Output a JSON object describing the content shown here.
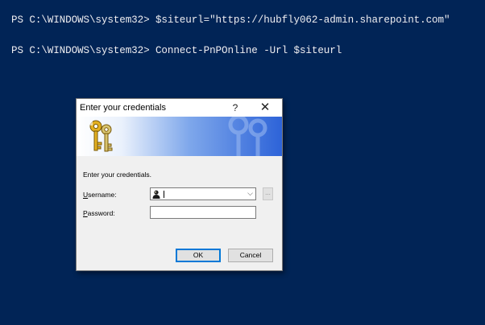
{
  "console": {
    "lines": [
      "PS C:\\WINDOWS\\system32> $siteurl=\"https://hubfly062-admin.sharepoint.com\"",
      "PS C:\\WINDOWS\\system32> Connect-PnPOnline -Url $siteurl"
    ]
  },
  "dialog": {
    "title": "Enter your credentials",
    "help_glyph": "?",
    "close_glyph": "✕",
    "prompt": "Enter your credentials.",
    "username_label_key": "U",
    "username_label_rest": "sername:",
    "username_value": "",
    "password_label_key": "P",
    "password_label_rest": "assword:",
    "browse_label": "...",
    "ok_label": "OK",
    "cancel_label": "Cancel"
  },
  "icons": {
    "banner": "keys-icon",
    "user": "user-icon",
    "dropdown": "chevron-down-icon"
  },
  "colors": {
    "console_bg": "#012456",
    "console_text": "#eeedf0",
    "banner_blue": "#2d63d8",
    "focus_border": "#0078d7"
  }
}
